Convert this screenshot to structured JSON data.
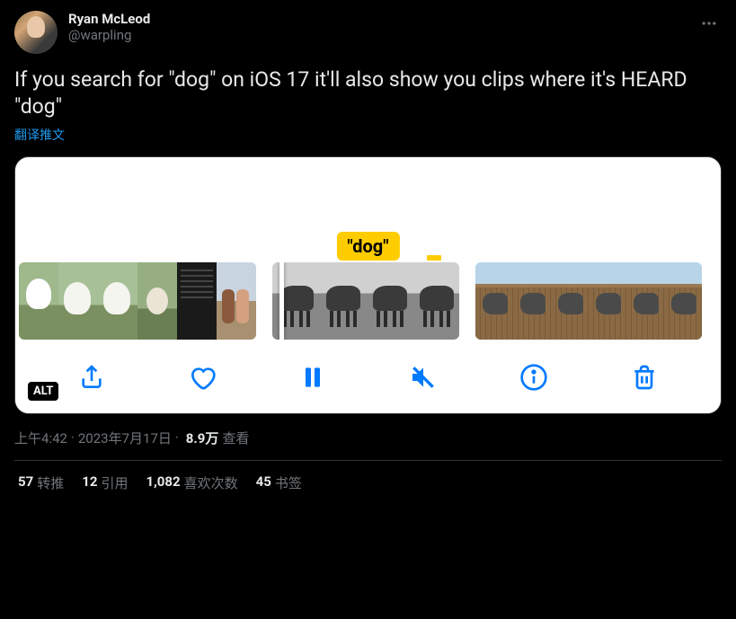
{
  "author": {
    "display_name": "Ryan McLeod",
    "handle": "@warpling"
  },
  "tweet_text": "If you search for \"dog\" on iOS 17 it'll also show you clips where it's HEARD \"dog\"",
  "translate_label": "翻译推文",
  "media": {
    "search_badge": "\"dog\"",
    "alt_badge": "ALT",
    "toolbar_icons": [
      "share",
      "like",
      "pause",
      "mute",
      "info",
      "delete"
    ]
  },
  "meta": {
    "time": "上午4:42",
    "date": "2023年7月17日",
    "separator": " · ",
    "views_count": "8.9万",
    "views_label": " 查看"
  },
  "stats": {
    "retweets": {
      "count": "57",
      "label": " 转推"
    },
    "quotes": {
      "count": "12",
      "label": " 引用"
    },
    "likes": {
      "count": "1,082",
      "label": " 喜欢次数"
    },
    "bookmarks": {
      "count": "45",
      "label": " 书签"
    }
  }
}
